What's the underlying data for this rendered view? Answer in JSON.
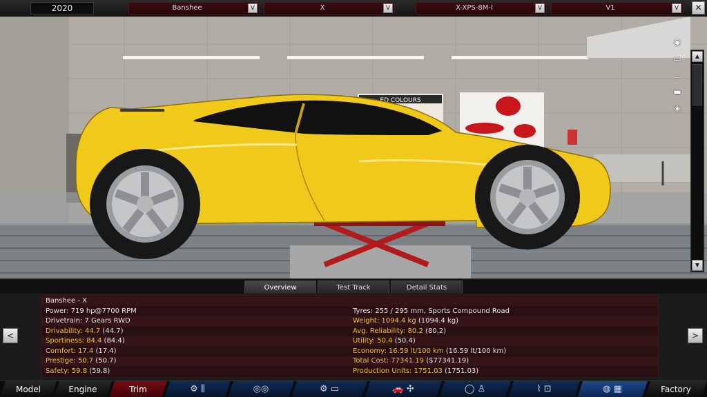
{
  "topbar": {
    "year": "2020",
    "model": "Banshee",
    "trim": "X",
    "engine": "X-XPS-8M-I",
    "variant": "V1",
    "dropdown_glyph": "V",
    "close_glyph": "✕"
  },
  "scene": {
    "poster_title": "ED COLOURS",
    "camera_icons": [
      "camera-icon",
      "car-front-icon",
      "car-side-icon",
      "car-rear-icon",
      "car-top-icon"
    ]
  },
  "tabs": [
    {
      "label": "Overview",
      "active": true
    },
    {
      "label": "Test Track",
      "active": false
    },
    {
      "label": "Detail Stats",
      "active": false
    }
  ],
  "overview": {
    "left": [
      {
        "text": "Banshee - X",
        "highlight": false
      },
      {
        "text": "Power: 719 hp@7700 RPM",
        "highlight": false
      },
      {
        "text": "Drivetrain: 7 Gears RWD",
        "highlight": false
      },
      {
        "text": "Drivability: 44.7",
        "extra": " (44.7)",
        "highlight": true
      },
      {
        "text": "Sportiness: 84.4",
        "extra": " (84.4)",
        "highlight": true
      },
      {
        "text": "Comfort: 17.4",
        "extra": " (17.4)",
        "highlight": true
      },
      {
        "text": "Prestige: 50.7",
        "extra": " (50.7)",
        "highlight": true
      },
      {
        "text": "Safety: 59.8",
        "extra": " (59.8)",
        "highlight": true
      }
    ],
    "right": [
      {
        "text": "",
        "highlight": false
      },
      {
        "text": "Tyres: 255 / 295 mm, Sports Compound Road",
        "highlight": false
      },
      {
        "text": "Weight: 1094.4 kg",
        "extra": " (1094.4 kg)",
        "highlight": true
      },
      {
        "text": "Avg. Reliability: 80.2",
        "extra": " (80.2)",
        "highlight": true
      },
      {
        "text": "Utility: 50.4",
        "extra": " (50.4)",
        "highlight": true
      },
      {
        "text": "Economy: 16.59 lt/100 km",
        "extra": " (16.59 lt/100 km)",
        "highlight": true
      },
      {
        "text": "Total Cost: 77341.19",
        "extra": " ($77341.19)",
        "highlight": true
      },
      {
        "text": "Production Units: 1751.03",
        "extra": " (1751.03)",
        "highlight": true
      }
    ],
    "prev_glyph": "<",
    "next_glyph": ">"
  },
  "nav": {
    "model": "Model",
    "engine": "Engine",
    "trim": "Trim",
    "factory": "Factory",
    "icons": [
      {
        "name": "chassis-icon",
        "glyph": "⚙ ⫼"
      },
      {
        "name": "wheels-icon",
        "glyph": "◎◎"
      },
      {
        "name": "engine-placement-icon",
        "glyph": "⚙ ▭"
      },
      {
        "name": "body-style-icon",
        "glyph": "🚗 ✣"
      },
      {
        "name": "interior-icon",
        "glyph": "◯ ♙"
      },
      {
        "name": "suspension-icon",
        "glyph": "⌇ ⊡"
      },
      {
        "name": "testing-icon",
        "glyph": "◍ ▦"
      }
    ],
    "colors": {
      "trim_active": "#7a0b12",
      "icon_bg": "#0f2b55",
      "highlight_text": "#e9c33d"
    }
  }
}
